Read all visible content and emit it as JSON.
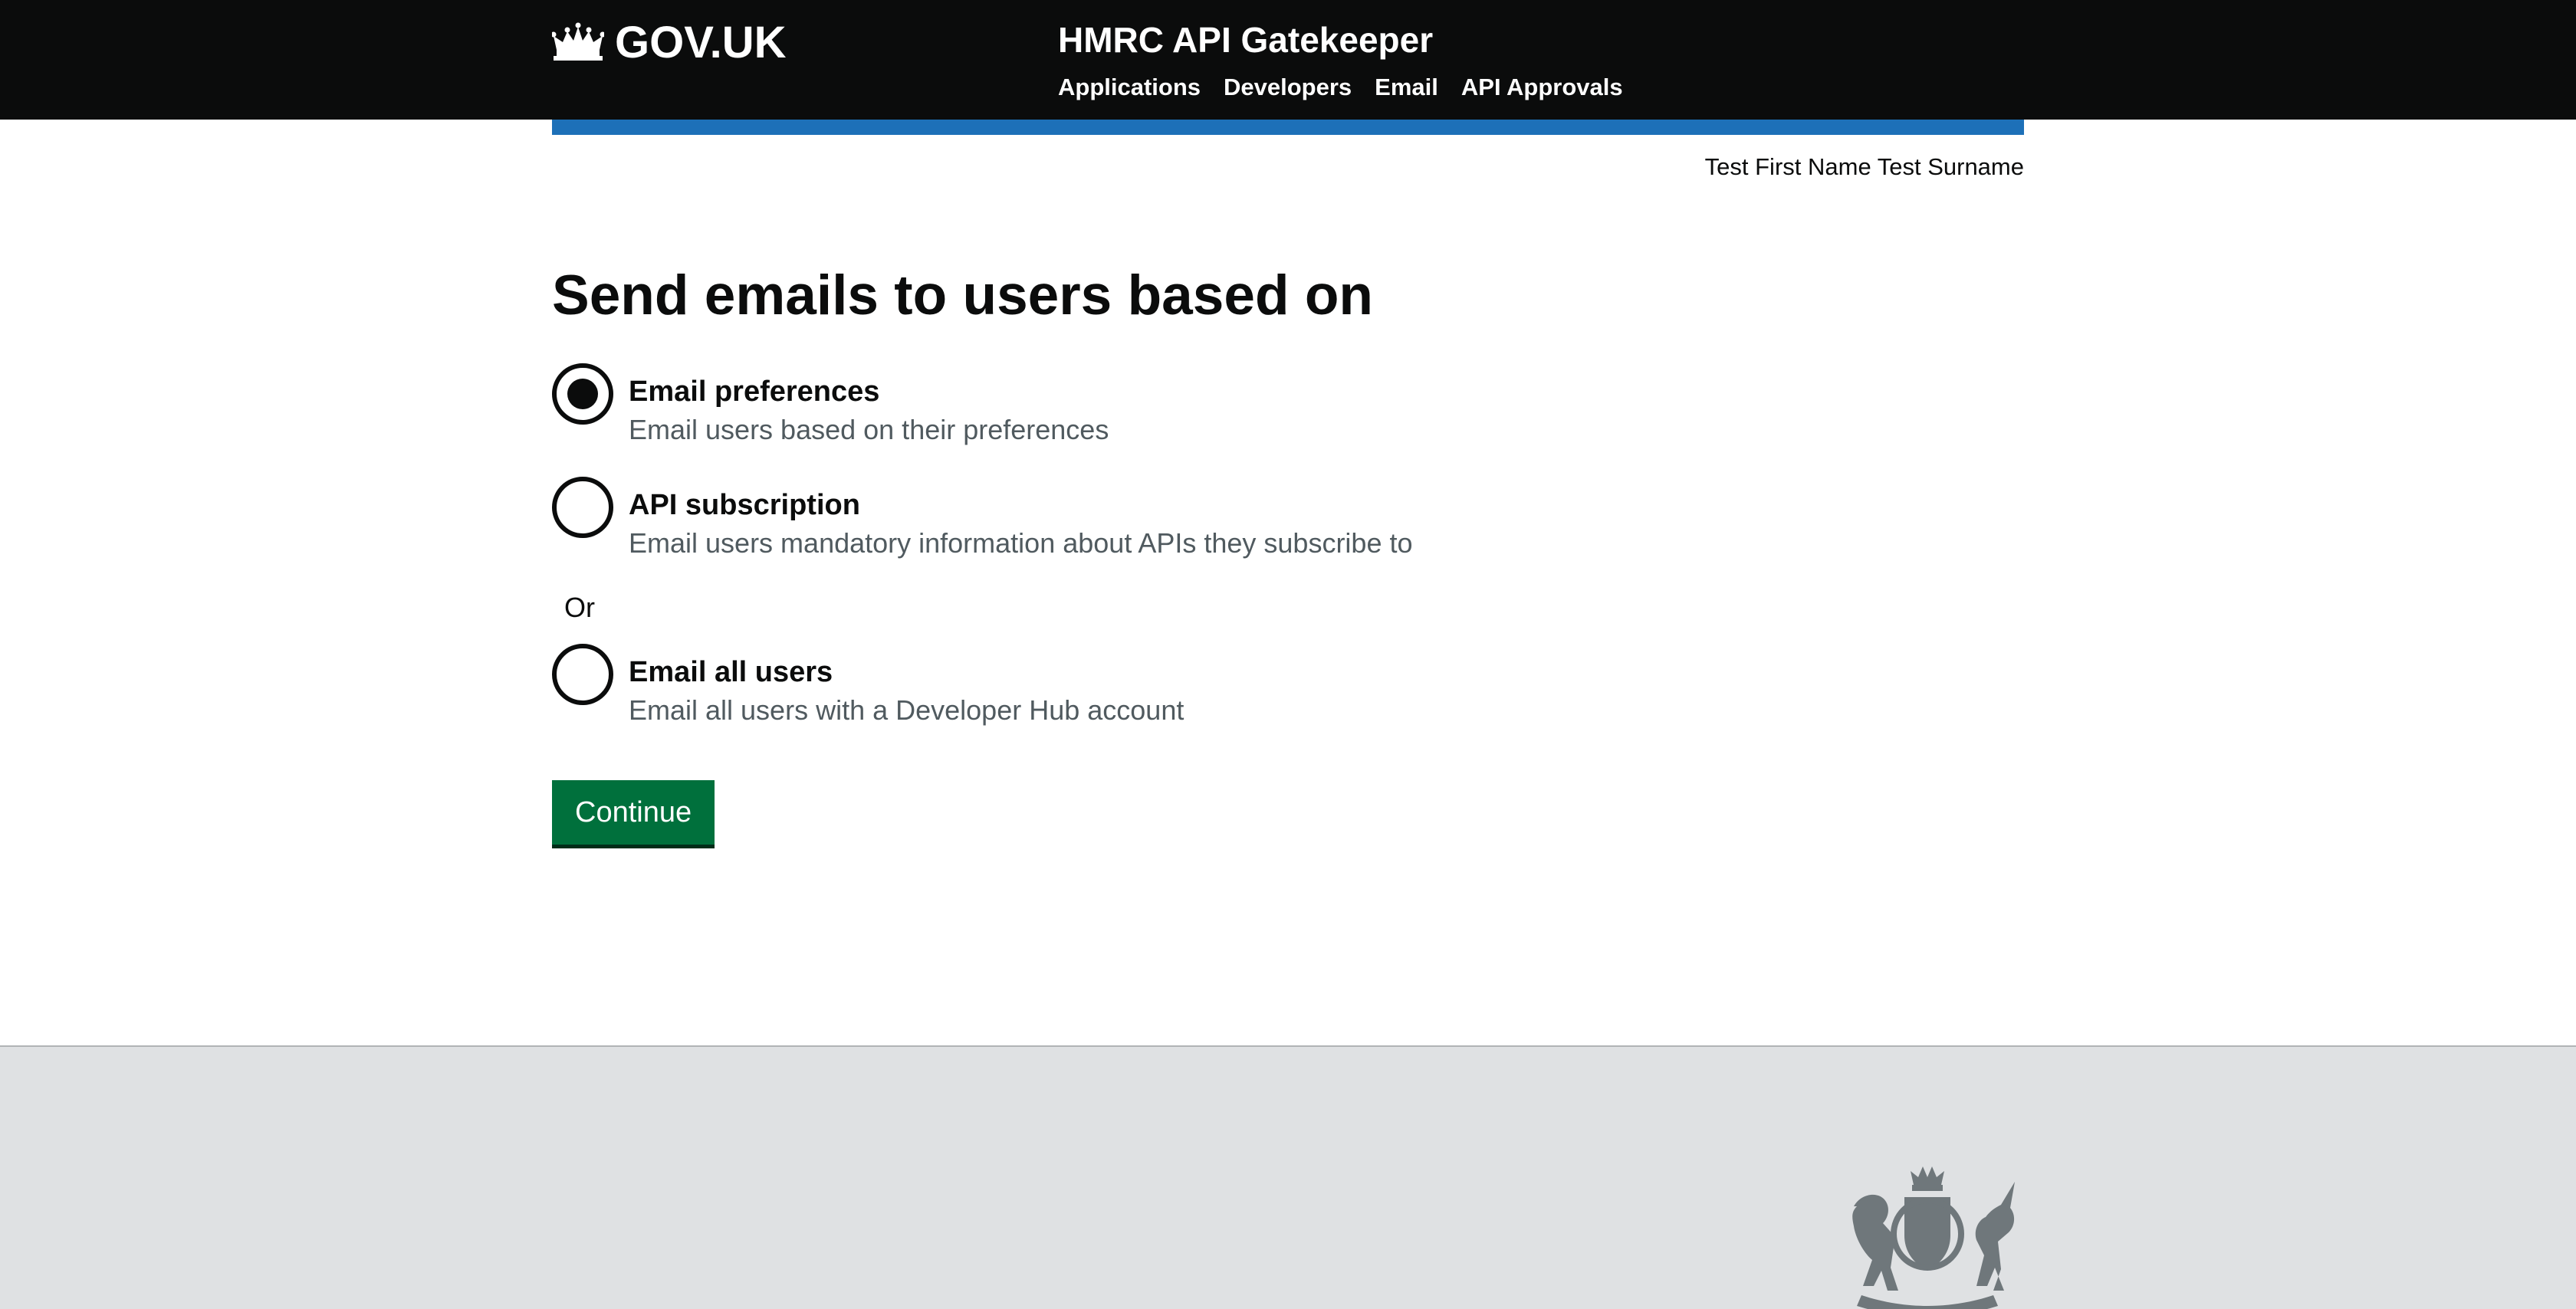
{
  "header": {
    "logo_text": "GOV.UK",
    "service_name": "HMRC API Gatekeeper",
    "nav": [
      {
        "label": "Applications"
      },
      {
        "label": "Developers"
      },
      {
        "label": "Email"
      },
      {
        "label": "API Approvals"
      }
    ]
  },
  "user": {
    "name": "Test First Name Test Surname"
  },
  "main": {
    "heading": "Send emails to users based on",
    "options": [
      {
        "label": "Email preferences",
        "hint": "Email users based on their preferences",
        "checked": true
      },
      {
        "label": "API subscription",
        "hint": "Email users mandatory information about APIs they subscribe to",
        "checked": false
      },
      {
        "label": "Email all users",
        "hint": "Email all users with a Developer Hub account",
        "checked": false
      }
    ],
    "or_text": "Or",
    "continue_label": "Continue"
  },
  "colors": {
    "header_bg": "#0b0c0c",
    "accent_blue": "#1d70b8",
    "button_green": "#00703c",
    "footer_bg": "#dfe1e3"
  }
}
